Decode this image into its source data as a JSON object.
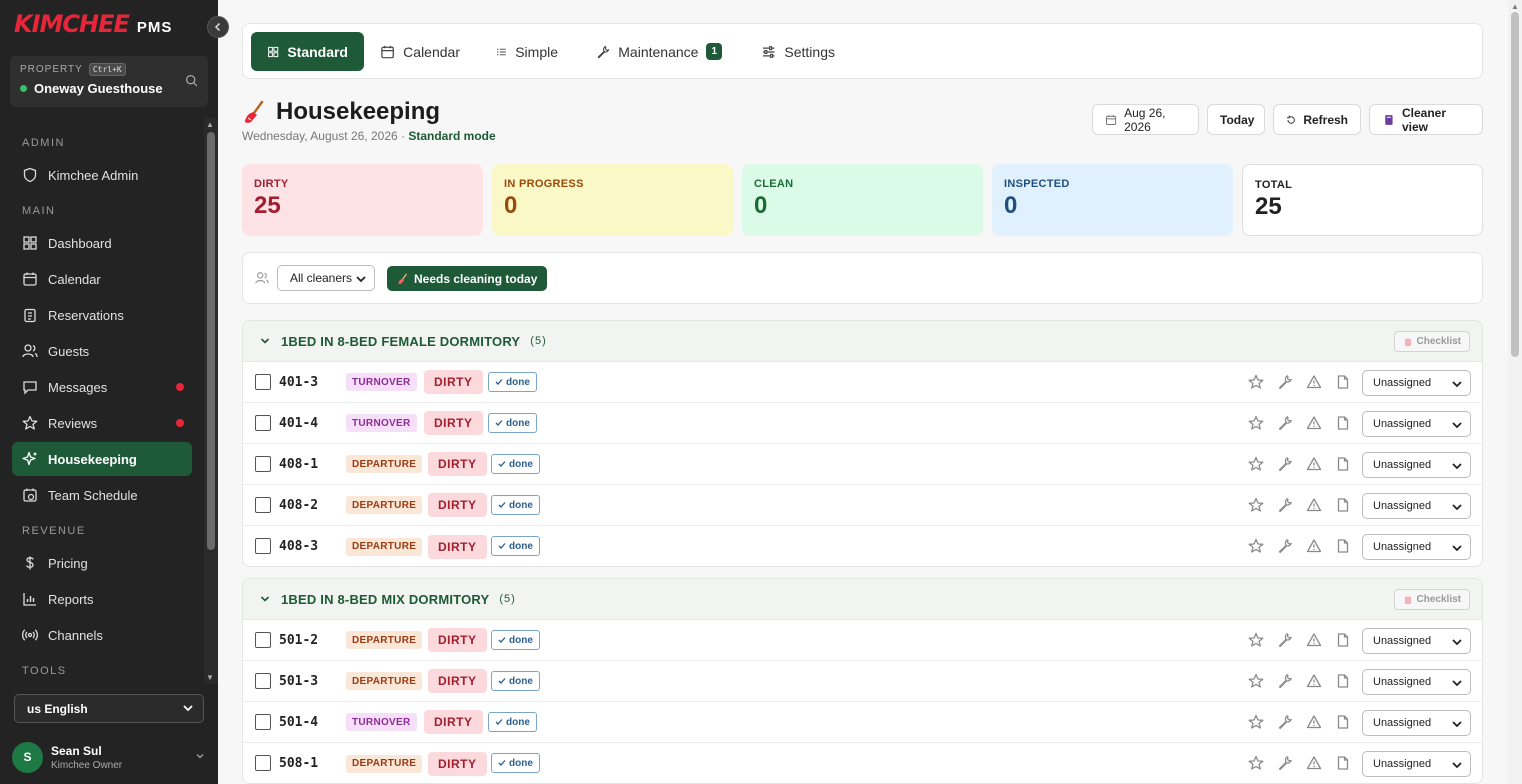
{
  "app": {
    "brand": "KIMCHEE",
    "suffix": "PMS"
  },
  "property": {
    "label": "PROPERTY",
    "shortcut": "Ctrl+K",
    "name": "Oneway Guesthouse"
  },
  "nav": {
    "sections": [
      {
        "title": "ADMIN",
        "items": [
          {
            "label": "Kimchee Admin",
            "icon": "shield-icon"
          }
        ]
      },
      {
        "title": "MAIN",
        "items": [
          {
            "label": "Dashboard",
            "icon": "grid-icon"
          },
          {
            "label": "Calendar",
            "icon": "calendar-icon"
          },
          {
            "label": "Reservations",
            "icon": "clipboard-icon"
          },
          {
            "label": "Guests",
            "icon": "users-icon"
          },
          {
            "label": "Messages",
            "icon": "message-icon",
            "dot": true
          },
          {
            "label": "Reviews",
            "icon": "star-icon",
            "dot": true
          },
          {
            "label": "Housekeeping",
            "icon": "sparkle-icon",
            "active": true
          },
          {
            "label": "Team Schedule",
            "icon": "schedule-icon"
          }
        ]
      },
      {
        "title": "REVENUE",
        "items": [
          {
            "label": "Pricing",
            "icon": "dollar-icon"
          },
          {
            "label": "Reports",
            "icon": "chart-icon"
          },
          {
            "label": "Channels",
            "icon": "broadcast-icon"
          }
        ]
      },
      {
        "title": "TOOLS",
        "items": []
      }
    ]
  },
  "language": {
    "value": "us English"
  },
  "user": {
    "initial": "S",
    "name": "Sean Sul",
    "role": "Kimchee Owner"
  },
  "tabs": [
    {
      "label": "Standard",
      "icon": "grid-icon",
      "active": true
    },
    {
      "label": "Calendar",
      "icon": "calendar-icon"
    },
    {
      "label": "Simple",
      "icon": "list-icon"
    },
    {
      "label": "Maintenance",
      "icon": "wrench-icon",
      "badge": "1"
    },
    {
      "label": "Settings",
      "icon": "sliders-icon"
    }
  ],
  "page": {
    "title": "Housekeeping",
    "date_text": "Wednesday, August 26, 2026 · ",
    "mode": "Standard mode"
  },
  "header_buttons": {
    "date": "Aug 26, 2026",
    "today": "Today",
    "refresh": "Refresh",
    "cleaner_view": "Cleaner view"
  },
  "stats": [
    {
      "label": "DIRTY",
      "value": "25",
      "bg": "#fde3e5",
      "fg": "#a31e2f"
    },
    {
      "label": "IN PROGRESS",
      "value": "0",
      "bg": "#fbf8c8",
      "fg": "#9a4a0a"
    },
    {
      "label": "CLEAN",
      "value": "0",
      "bg": "#dbfbe8",
      "fg": "#1b6b35"
    },
    {
      "label": "INSPECTED",
      "value": "0",
      "bg": "#e1f0fd",
      "fg": "#1f4f7e"
    },
    {
      "label": "TOTAL",
      "value": "25",
      "bg": "#ffffff",
      "fg": "#222222"
    }
  ],
  "filters": {
    "cleaner_select": "All cleaners",
    "needs_cleaning": "Needs cleaning today"
  },
  "groups": [
    {
      "title": "1BED IN 8-BED FEMALE DORMITORY",
      "count": "(5)",
      "checklist": "Checklist",
      "rows": [
        {
          "room": "401-3",
          "tag": "TURNOVER",
          "status": "DIRTY",
          "done": "done",
          "assignee": "Unassigned"
        },
        {
          "room": "401-4",
          "tag": "TURNOVER",
          "status": "DIRTY",
          "done": "done",
          "assignee": "Unassigned"
        },
        {
          "room": "408-1",
          "tag": "DEPARTURE",
          "status": "DIRTY",
          "done": "done",
          "assignee": "Unassigned"
        },
        {
          "room": "408-2",
          "tag": "DEPARTURE",
          "status": "DIRTY",
          "done": "done",
          "assignee": "Unassigned"
        },
        {
          "room": "408-3",
          "tag": "DEPARTURE",
          "status": "DIRTY",
          "done": "done",
          "assignee": "Unassigned"
        }
      ]
    },
    {
      "title": "1BED IN 8-BED MIX DORMITORY",
      "count": "(5)",
      "checklist": "Checklist",
      "rows": [
        {
          "room": "501-2",
          "tag": "DEPARTURE",
          "status": "DIRTY",
          "done": "done",
          "assignee": "Unassigned"
        },
        {
          "room": "501-3",
          "tag": "DEPARTURE",
          "status": "DIRTY",
          "done": "done",
          "assignee": "Unassigned"
        },
        {
          "room": "501-4",
          "tag": "TURNOVER",
          "status": "DIRTY",
          "done": "done",
          "assignee": "Unassigned"
        },
        {
          "room": "508-1",
          "tag": "DEPARTURE",
          "status": "DIRTY",
          "done": "done",
          "assignee": "Unassigned"
        }
      ]
    }
  ]
}
